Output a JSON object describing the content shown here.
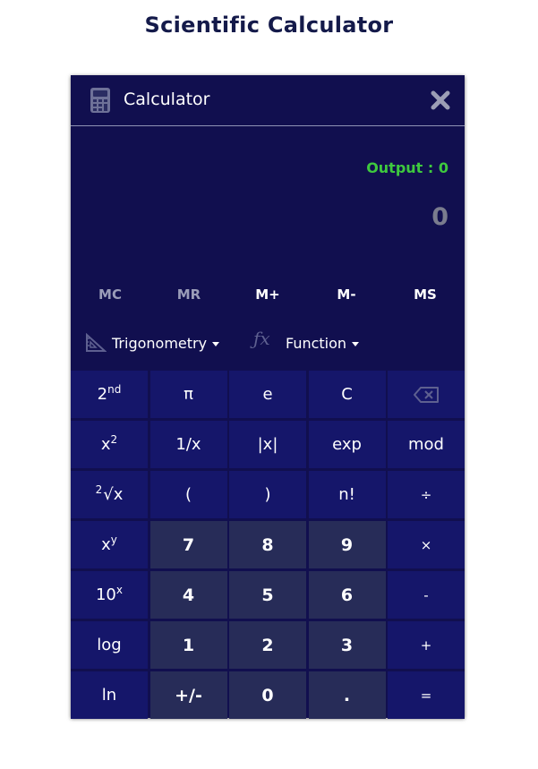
{
  "page": {
    "title": "Scientific Calculator"
  },
  "app": {
    "title": "Calculator"
  },
  "display": {
    "output_text": "Output : 0",
    "result": "0"
  },
  "memory": [
    "MC",
    "MR",
    "M+",
    "M-",
    "MS"
  ],
  "dropdowns": {
    "trig_label": "Trigonometry",
    "func_label": "Function"
  },
  "colors": {
    "calculator_bg": "#110f4f",
    "key_bg": "#15166a",
    "number_key_bg": "#272c58",
    "output_green": "#3ec93e",
    "result_gray": "#7a7c8e"
  },
  "keys": {
    "pi": "π",
    "e": "e",
    "clear": "C",
    "reciprocal": "1/x",
    "abs": "|x|",
    "exp": "exp",
    "mod": "mod",
    "open_paren": "(",
    "close_paren": ")",
    "factorial": "n!",
    "divide": "÷",
    "seven": "7",
    "eight": "8",
    "nine": "9",
    "multiply": "×",
    "four": "4",
    "five": "5",
    "six": "6",
    "minus": "-",
    "log": "log",
    "one": "1",
    "two": "2",
    "three": "3",
    "plus": "+",
    "ln": "ln",
    "negate": "+/-",
    "zero": "0",
    "decimal": ".",
    "equals": "=",
    "second": {
      "base": "2",
      "sup": "nd"
    },
    "square": {
      "base": "x",
      "sup": "2"
    },
    "sqrt": {
      "pre": "2",
      "base": "√x"
    },
    "power": {
      "base": "x",
      "sup": "y"
    },
    "ten_power": {
      "base": "10",
      "sup": "x"
    }
  }
}
